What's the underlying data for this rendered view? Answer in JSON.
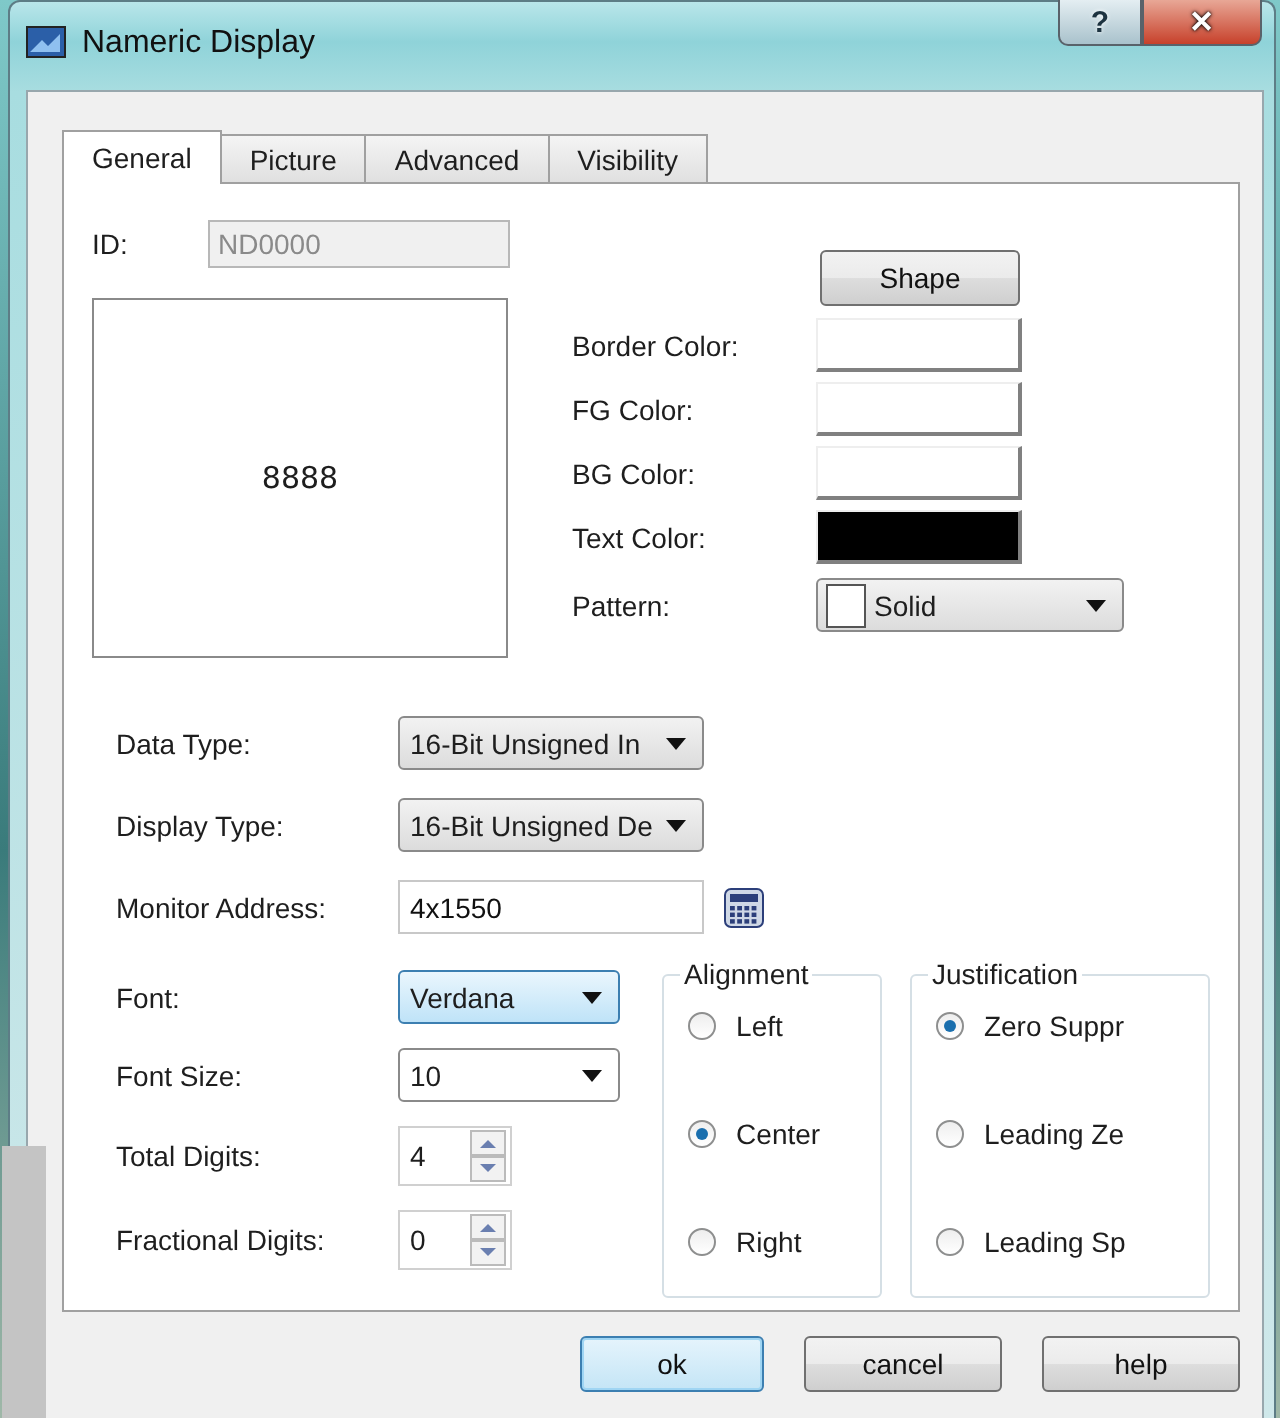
{
  "window": {
    "title": "Nameric Display"
  },
  "title_buttons": [
    {
      "kind": "help",
      "text": "?"
    },
    {
      "kind": "close",
      "text": "✕"
    }
  ],
  "tabs": [
    {
      "label": "General",
      "selected": true
    },
    {
      "label": "Picture",
      "selected": false
    },
    {
      "label": "Advanced",
      "selected": false
    },
    {
      "label": "Visibility",
      "selected": false
    }
  ],
  "id_field": {
    "label": "ID:",
    "value": "ND0000",
    "disabled": true
  },
  "preview": {
    "text": "8888"
  },
  "shape_button": "Shape",
  "colors": [
    {
      "label": "Border Color:",
      "color": "#ffffff"
    },
    {
      "label": "FG Color:",
      "color": "#ffffff"
    },
    {
      "label": "BG Color:",
      "color": "#ffffff"
    },
    {
      "label": "Text Color:",
      "color": "#000000"
    }
  ],
  "pattern": {
    "label": "Pattern:",
    "value": "Solid"
  },
  "fields": [
    {
      "kind": "dropdown",
      "label": "Data Type:",
      "value": "16-Bit Unsigned In",
      "focused": false
    },
    {
      "kind": "dropdown",
      "label": "Display Type:",
      "value": "16-Bit Unsigned De",
      "focused": false
    },
    {
      "kind": "address",
      "label": "Monitor Address:",
      "value": "4x1550"
    }
  ],
  "format_fields": [
    {
      "kind": "combo",
      "label": "Font:",
      "value": "Verdana",
      "focused": true
    },
    {
      "kind": "combo",
      "label": "Font Size:",
      "value": "10",
      "focused": false
    },
    {
      "kind": "spinner",
      "label": "Total Digits:",
      "value": "4"
    },
    {
      "kind": "spinner",
      "label": "Fractional Digits:",
      "value": "0"
    }
  ],
  "groups": [
    {
      "title": "Alignment",
      "options": [
        {
          "label": "Left",
          "selected": false
        },
        {
          "label": "Center",
          "selected": true
        },
        {
          "label": "Right",
          "selected": false
        }
      ]
    },
    {
      "title": "Justification",
      "options": [
        {
          "label": "Zero Suppr",
          "selected": true
        },
        {
          "label": "Leading Ze",
          "selected": false
        },
        {
          "label": "Leading Sp",
          "selected": false
        }
      ]
    }
  ],
  "buttons": [
    {
      "label": "ok",
      "default": true
    },
    {
      "label": "cancel",
      "default": false
    },
    {
      "label": "help",
      "default": false
    }
  ]
}
